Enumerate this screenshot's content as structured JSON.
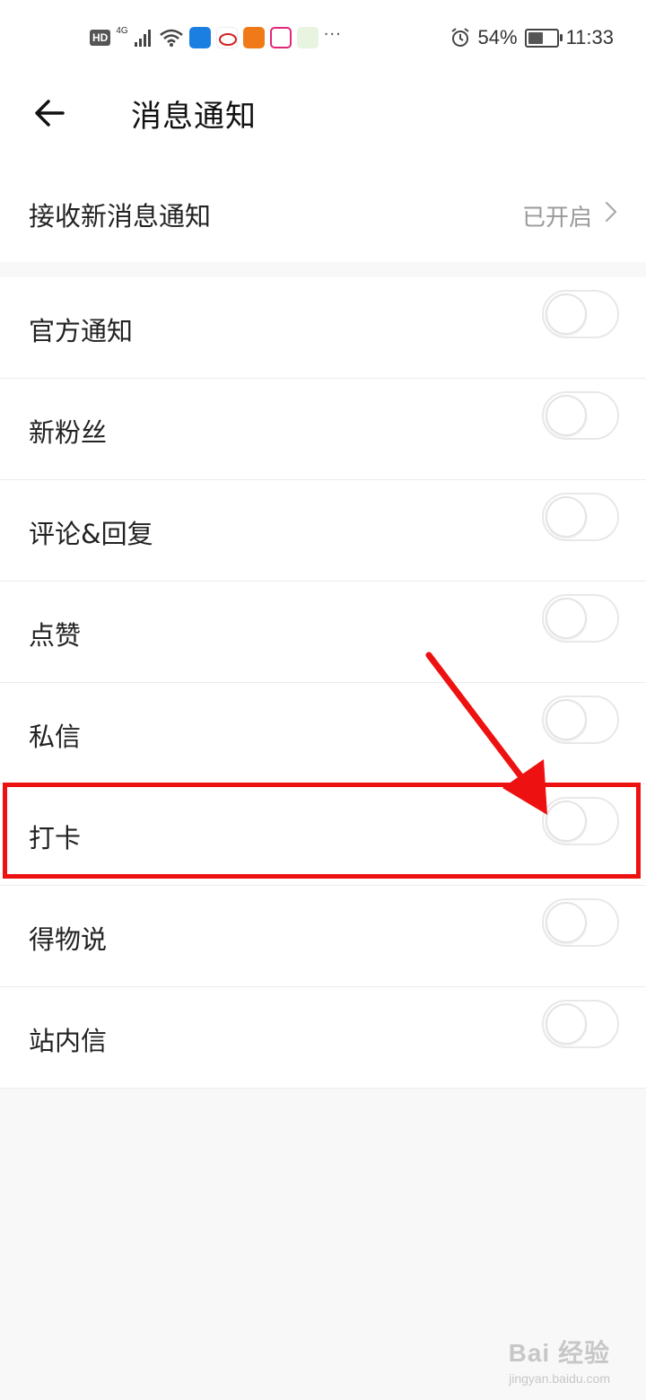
{
  "status_bar": {
    "hd": "HD",
    "network": "4G",
    "alarm_icon": "alarm-icon",
    "battery_percent": "54%",
    "battery_level": 0.54,
    "time": "11:33",
    "more": "···"
  },
  "header": {
    "back_icon": "arrow-left-icon",
    "title": "消息通知"
  },
  "receive": {
    "label": "接收新消息通知",
    "status": "已开启"
  },
  "items": [
    {
      "label": "官方通知",
      "enabled": false
    },
    {
      "label": "新粉丝",
      "enabled": false
    },
    {
      "label": "评论&回复",
      "enabled": false
    },
    {
      "label": "点赞",
      "enabled": false
    },
    {
      "label": "私信",
      "enabled": false
    },
    {
      "label": "打卡",
      "enabled": false
    },
    {
      "label": "得物说",
      "enabled": false
    },
    {
      "label": "站内信",
      "enabled": false
    }
  ],
  "annotation": {
    "color": "#ee1111"
  },
  "watermark": {
    "main": "Bai 经验",
    "sub": "jingyan.baidu.com"
  }
}
